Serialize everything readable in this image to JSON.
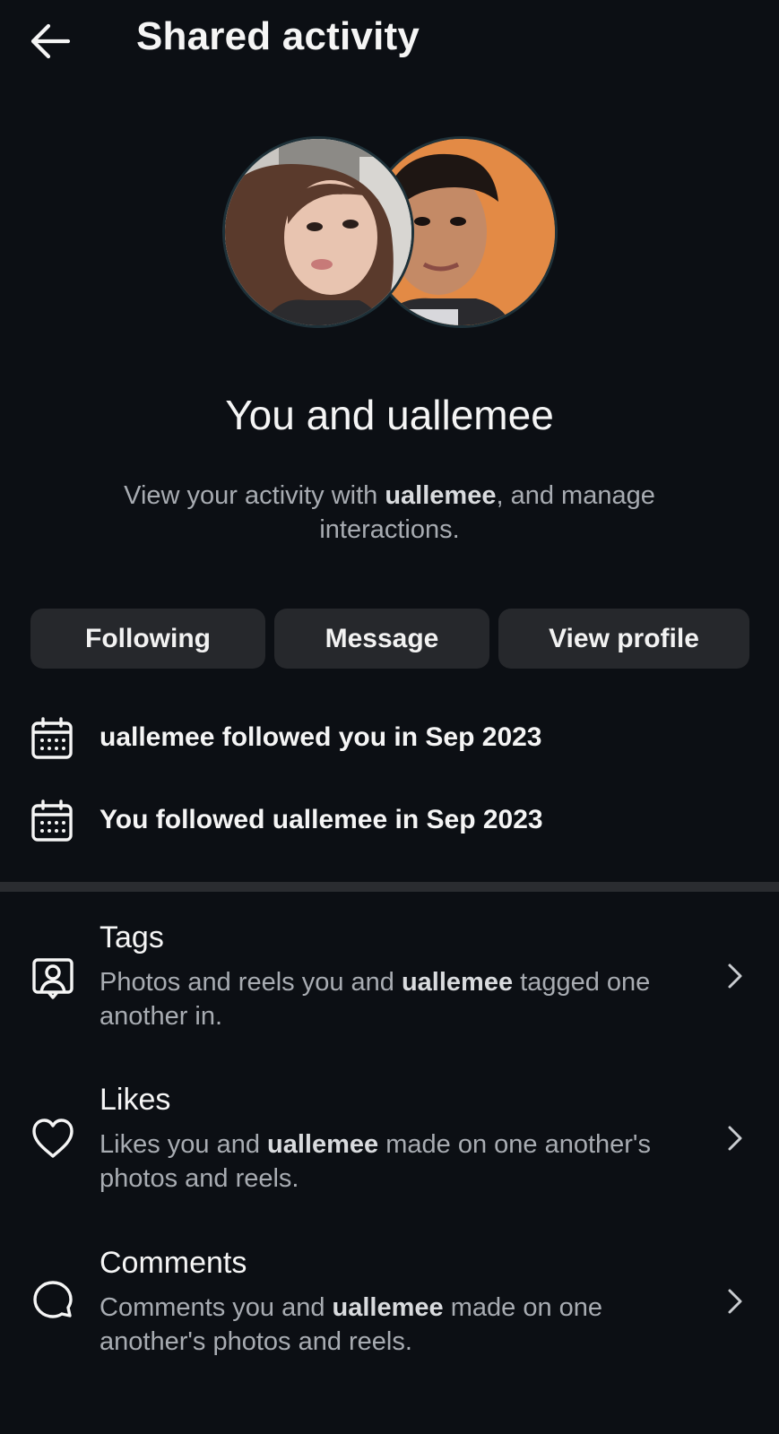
{
  "header": {
    "title": "Shared activity"
  },
  "profile": {
    "title": "You and uallemee",
    "description_before": "View your activity with ",
    "username": "uallemee",
    "description_after": ", and manage interactions."
  },
  "actions": {
    "following": "Following",
    "message": "Message",
    "view_profile": "View profile"
  },
  "follow_info": [
    {
      "text": "uallemee followed you in Sep 2023",
      "icon": "calendar-icon"
    },
    {
      "text": "You followed uallemee in Sep 2023",
      "icon": "calendar-icon"
    }
  ],
  "menu": [
    {
      "title": "Tags",
      "desc_before": "Photos and reels you and ",
      "username": "uallemee",
      "desc_after": " tagged one another in.",
      "icon": "tag-person-icon"
    },
    {
      "title": "Likes",
      "desc_before": "Likes you and ",
      "username": "uallemee",
      "desc_after": " made on one another's photos and reels.",
      "icon": "heart-icon"
    },
    {
      "title": "Comments",
      "desc_before": "Comments you and ",
      "username": "uallemee",
      "desc_after": " made on one another's photos and reels.",
      "icon": "comment-bubble-icon"
    }
  ],
  "colors": {
    "background": "#0c0f14",
    "button_bg": "#26282c",
    "secondary_text": "#a8acb2"
  }
}
